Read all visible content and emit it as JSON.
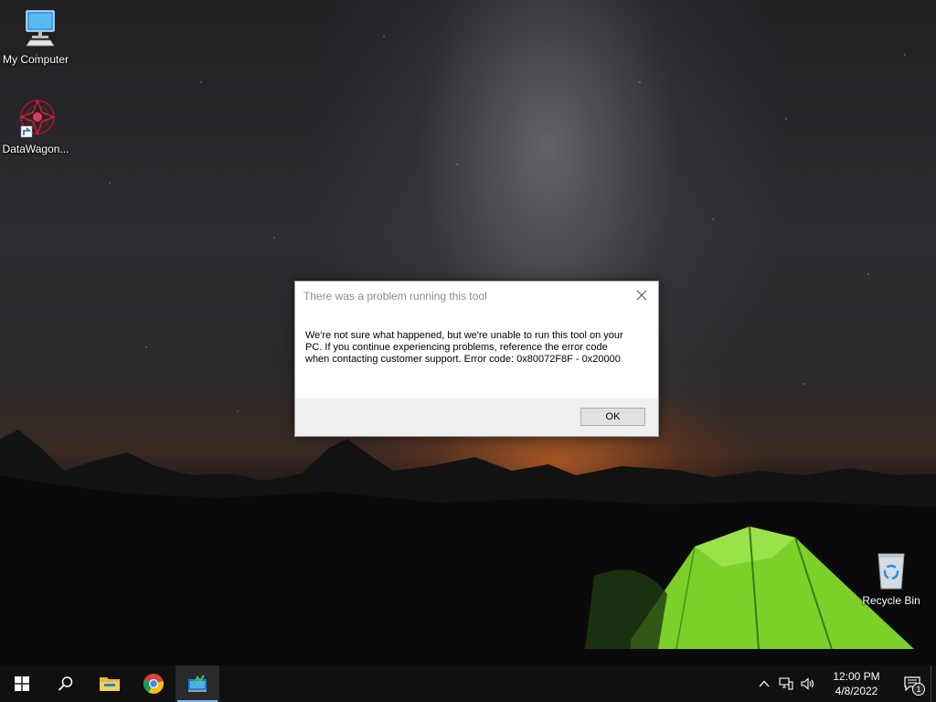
{
  "desktop": {
    "icons": [
      {
        "label": "My Computer",
        "icon": "computer-icon"
      },
      {
        "label": "DataWagon...",
        "icon": "datawagon-icon"
      },
      {
        "label": "Recycle Bin",
        "icon": "recycle-bin-icon"
      }
    ]
  },
  "dialog": {
    "title": "There was a problem running this tool",
    "message": "We're not sure what happened, but we're unable to run this tool on your PC. If you continue experiencing problems, reference the error code when contacting customer support. Error code: 0x80072F8F - 0x20000",
    "ok_label": "OK",
    "close_icon": "close-icon"
  },
  "taskbar": {
    "apps": [
      {
        "name": "start",
        "icon": "windows-logo-icon"
      },
      {
        "name": "search",
        "icon": "search-icon"
      },
      {
        "name": "file-explorer",
        "icon": "folder-icon"
      },
      {
        "name": "chrome",
        "icon": "chrome-icon"
      },
      {
        "name": "media-creation-tool",
        "icon": "media-tool-icon"
      }
    ],
    "clock": {
      "time": "12:00 PM",
      "date": "4/8/2022"
    },
    "notification_count": "1",
    "colors": {
      "active_underline": "#76b9ed",
      "taskbar_bg": "#101010"
    }
  }
}
